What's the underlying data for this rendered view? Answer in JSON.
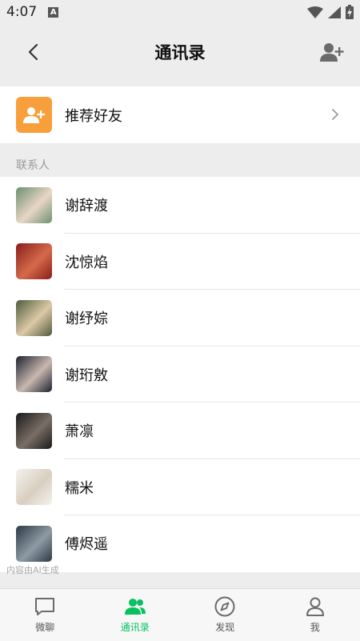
{
  "status_bar": {
    "time": "4:07",
    "notification_glyph": "A"
  },
  "header": {
    "title": "通讯录"
  },
  "recommend": {
    "label": "推荐好友"
  },
  "section": {
    "contacts_label": "联系人"
  },
  "contacts": [
    {
      "name": "谢辞渡",
      "avatar_colors": [
        "#6b8f6f",
        "#e9d6c6"
      ]
    },
    {
      "name": "沈惊焰",
      "avatar_colors": [
        "#8a1c1c",
        "#d46a4a"
      ]
    },
    {
      "name": "谢纾婃",
      "avatar_colors": [
        "#4f5a3e",
        "#dcc9a6"
      ]
    },
    {
      "name": "谢珩敫",
      "avatar_colors": [
        "#1c2230",
        "#c9b8b0"
      ]
    },
    {
      "name": "萧凛",
      "avatar_colors": [
        "#1a1a1a",
        "#7a6e66"
      ]
    },
    {
      "name": "糯米",
      "avatar_colors": [
        "#f4f2ee",
        "#d9cfc0"
      ]
    },
    {
      "name": "傅烬遥",
      "avatar_colors": [
        "#2c3a46",
        "#8e9aa4"
      ]
    }
  ],
  "watermark": "内容由AI生成",
  "tabs": [
    {
      "label": "微聊",
      "icon": "chat-bubble-icon",
      "active": false
    },
    {
      "label": "通讯录",
      "icon": "contacts-icon",
      "active": true
    },
    {
      "label": "发现",
      "icon": "compass-icon",
      "active": false
    },
    {
      "label": "我",
      "icon": "person-icon",
      "active": false
    }
  ],
  "colors": {
    "accent": "#07c160",
    "recommend_icon_bg": "#f7a03b",
    "background": "#ededed"
  }
}
